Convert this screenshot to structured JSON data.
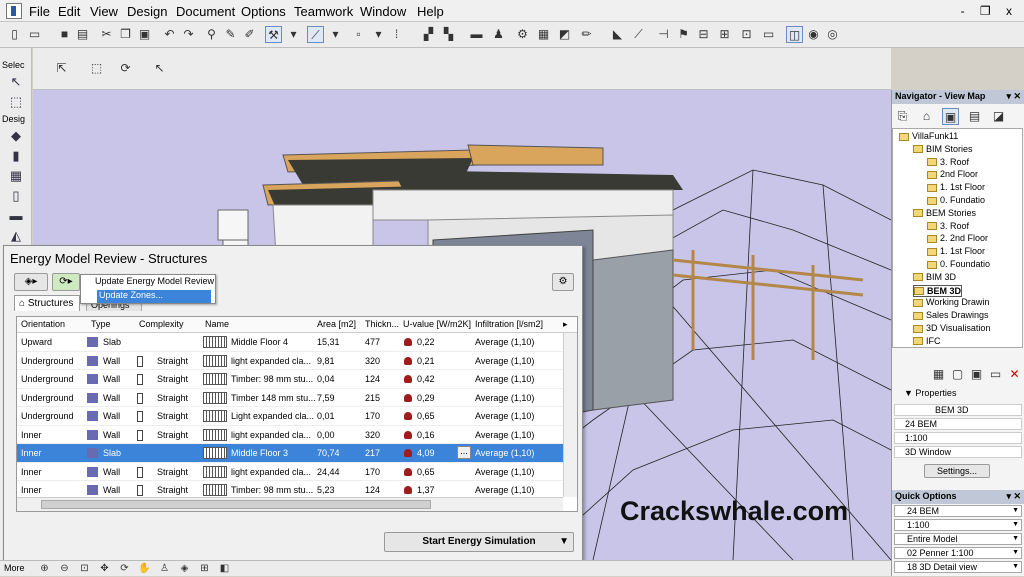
{
  "menubar": {
    "items": [
      "File",
      "Edit",
      "View",
      "Design",
      "Document",
      "Options",
      "Teamwork",
      "Window",
      "Help"
    ],
    "window_controls": "- ❐ x"
  },
  "toolbox": {
    "select_label": "Selec",
    "design_label": "Desig"
  },
  "navigator": {
    "title": "Navigator - View Map",
    "tree": [
      "VillaFunk11",
      "BIM Stories",
      "3. Roof",
      "2nd Floor",
      "1. 1st Floor",
      "0. Fundatio",
      "BEM Stories",
      "3. Roof",
      "2. 2nd Floor",
      "1. 1st Floor",
      "0. Foundatio",
      "BIM 3D",
      "BEM 3D",
      "Working Drawin",
      "Sales Drawings",
      "3D Visualisation",
      "IFC"
    ],
    "properties_label": "Properties",
    "prop_name": "BEM 3D",
    "prop_rows": [
      "24 BEM",
      "1:100",
      "3D Window"
    ],
    "settings_button": "Settings..."
  },
  "quick_options": {
    "title": "Quick Options",
    "rows": [
      "24 BEM",
      "1:100",
      "Entire Model",
      "02 Penner 1:100",
      "18 3D Detail view"
    ]
  },
  "dialog": {
    "title": "Energy Model Review - Structures",
    "tab_structures": "Structures",
    "tab_openings": "Openings",
    "popup_item_1": "Update Energy Model Review",
    "popup_item_2": "Update Zones...",
    "start_button": "Start Energy Simulation",
    "columns": [
      "Orientation",
      "Type",
      "Complexity",
      "Name",
      "Area [m2]",
      "Thickn...",
      "U-value [W/m2K]",
      "Infiltration [l/sm2]"
    ],
    "rows": [
      {
        "orientation": "Upward",
        "type": "Slab",
        "complexity": "",
        "name": "Middle Floor 4",
        "area": "15,31",
        "thick": "477",
        "u": "0,22",
        "infil": "Average (1,10)"
      },
      {
        "orientation": "Underground",
        "type": "Wall",
        "complexity": "Straight",
        "name": "light expanded cla...",
        "area": "9,81",
        "thick": "320",
        "u": "0,21",
        "infil": "Average (1,10)"
      },
      {
        "orientation": "Underground",
        "type": "Wall",
        "complexity": "Straight",
        "name": "Timber: 98 mm stu...",
        "area": "0,04",
        "thick": "124",
        "u": "0,42",
        "infil": "Average (1,10)"
      },
      {
        "orientation": "Underground",
        "type": "Wall",
        "complexity": "Straight",
        "name": "Timber 148 mm stu...",
        "area": "7,59",
        "thick": "215",
        "u": "0,29",
        "infil": "Average (1,10)"
      },
      {
        "orientation": "Underground",
        "type": "Wall",
        "complexity": "Straight",
        "name": "Light expanded cla...",
        "area": "0,01",
        "thick": "170",
        "u": "0,65",
        "infil": "Average (1,10)"
      },
      {
        "orientation": "Inner",
        "type": "Wall",
        "complexity": "Straight",
        "name": "light expanded cla...",
        "area": "0,00",
        "thick": "320",
        "u": "0,16",
        "infil": "Average (1,10)"
      },
      {
        "orientation": "Inner",
        "type": "Slab",
        "complexity": "",
        "name": "Middle Floor 3",
        "area": "70,74",
        "thick": "217",
        "u": "4,09",
        "infil": "Average (1,10)"
      },
      {
        "orientation": "Inner",
        "type": "Wall",
        "complexity": "Straight",
        "name": "light expanded cla...",
        "area": "24,44",
        "thick": "170",
        "u": "0,65",
        "infil": "Average (1,10)"
      },
      {
        "orientation": "Inner",
        "type": "Wall",
        "complexity": "Straight",
        "name": "Timber: 98 mm stu...",
        "area": "5,23",
        "thick": "124",
        "u": "1,37",
        "infil": "Average (1,10)"
      }
    ],
    "selected_row": 6
  },
  "statusbar": {
    "more_label": "More"
  },
  "watermark": "Crackswhale.com"
}
